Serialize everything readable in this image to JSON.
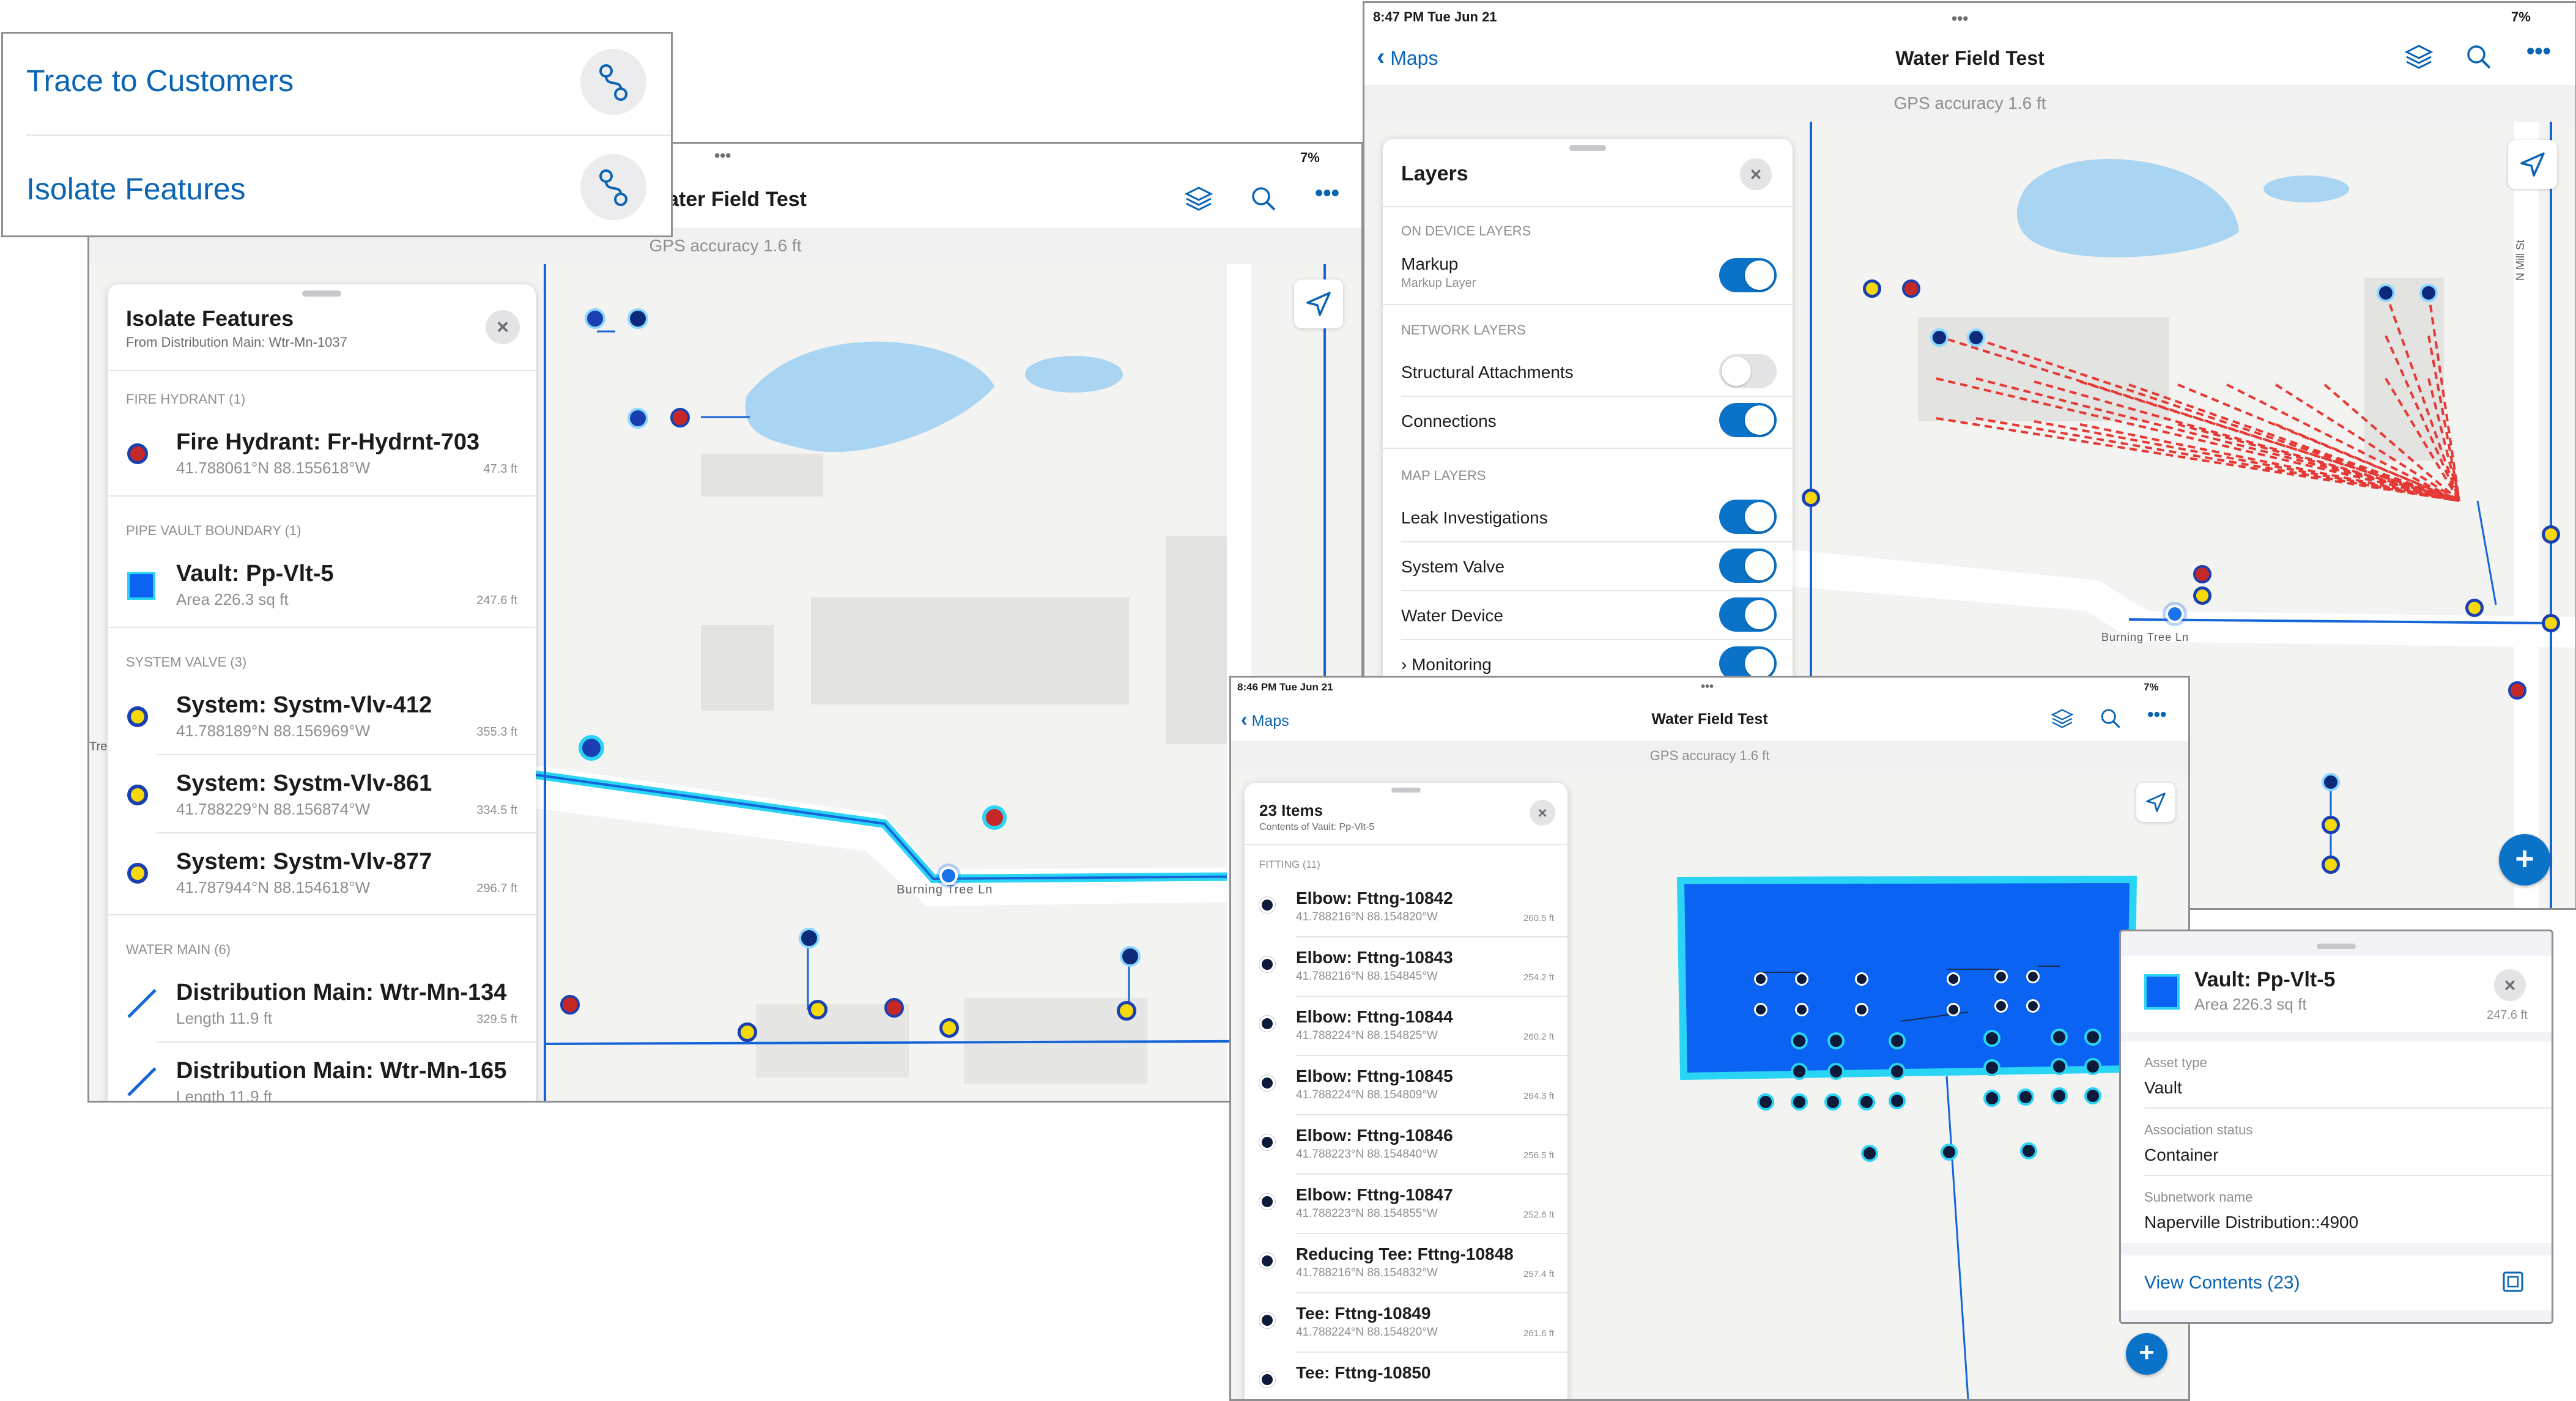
{
  "menu": {
    "trace_label": "Trace to Customers",
    "isolate_label": "Isolate Features"
  },
  "screen_left": {
    "status_battery": "7%",
    "title": "ater Field Test",
    "gps": "GPS accuracy 1.6 ft",
    "street": "Burning Tree Ln",
    "edge_label": "Tre",
    "panel": {
      "title": "Isolate Features",
      "subtitle": "From Distribution Main: Wtr-Mn-1037",
      "sections": {
        "fire_hydrant": "FIRE HYDRANT  (1)",
        "pipe_vault": "PIPE VAULT BOUNDARY  (1)",
        "system_valve": "SYSTEM VALVE  (3)",
        "water_main": "WATER MAIN  (6)"
      },
      "rows": [
        {
          "title": "Fire Hydrant: Fr-Hydrnt-703",
          "sub": "41.788061°N  88.155618°W",
          "dist": "47.3 ft"
        },
        {
          "title": "Vault: Pp-Vlt-5",
          "sub": "Area 226.3 sq ft",
          "dist": "247.6 ft"
        },
        {
          "title": "System: Systm-Vlv-412",
          "sub": "41.788189°N  88.156969°W",
          "dist": "355.3 ft"
        },
        {
          "title": "System: Systm-Vlv-861",
          "sub": "41.788229°N  88.156874°W",
          "dist": "334.5 ft"
        },
        {
          "title": "System: Systm-Vlv-877",
          "sub": "41.787944°N  88.154618°W",
          "dist": "296.7 ft"
        },
        {
          "title": "Distribution Main: Wtr-Mn-134",
          "sub": "Length 11.9 ft",
          "dist": "329.5 ft"
        },
        {
          "title": "Distribution Main: Wtr-Mn-165",
          "sub": "Length 11.9 ft",
          "dist": ""
        }
      ]
    }
  },
  "screen_right": {
    "time": "8:47 PM   Tue Jun 21",
    "status_battery": "7%",
    "back": "Maps",
    "title": "Water Field Test",
    "gps": "GPS accuracy 1.6 ft",
    "street": "Burning Tree Ln",
    "street_vertical": "N Mill St",
    "layers": {
      "title": "Layers",
      "on_device": "ON DEVICE LAYERS",
      "markup": "Markup",
      "markup_sub": "Markup Layer",
      "network": "NETWORK LAYERS",
      "structural": "Structural Attachments",
      "connections": "Connections",
      "map_layers": "MAP LAYERS",
      "leak": "Leak Investigations",
      "system_valve": "System Valve",
      "water_device": "Water Device",
      "monitoring": "Monitoring"
    }
  },
  "screen_bottom": {
    "time": "8:46 PM   Tue Jun 21",
    "status_battery": "7%",
    "back": "Maps",
    "title": "Water Field Test",
    "gps": "GPS accuracy 1.6 ft",
    "list": {
      "title": "23 Items",
      "subtitle": "Contents of Vault: Pp-Vlt-5",
      "section": "FITTING  (11)",
      "rows": [
        {
          "title": "Elbow: Fttng-10842",
          "sub": "41.788216°N  88.154820°W",
          "dist": "260.5 ft"
        },
        {
          "title": "Elbow: Fttng-10843",
          "sub": "41.788216°N  88.154845°W",
          "dist": "254.2 ft"
        },
        {
          "title": "Elbow: Fttng-10844",
          "sub": "41.788224°N  88.154825°W",
          "dist": "260.2 ft"
        },
        {
          "title": "Elbow: Fttng-10845",
          "sub": "41.788224°N  88.154809°W",
          "dist": "264.3 ft"
        },
        {
          "title": "Elbow: Fttng-10846",
          "sub": "41.788223°N  88.154840°W",
          "dist": "256.5 ft"
        },
        {
          "title": "Elbow: Fttng-10847",
          "sub": "41.788223°N  88.154855°W",
          "dist": "252.6 ft"
        },
        {
          "title": "Reducing Tee: Fttng-10848",
          "sub": "41.788216°N  88.154832°W",
          "dist": "257.4 ft"
        },
        {
          "title": "Tee: Fttng-10849",
          "sub": "41.788224°N  88.154820°W",
          "dist": "261.6 ft"
        },
        {
          "title": "Tee: Fttng-10850",
          "sub": "",
          "dist": ""
        }
      ]
    }
  },
  "vault_card": {
    "title": "Vault: Pp-Vlt-5",
    "sub": "Area 226.3 sq ft",
    "dist": "247.6 ft",
    "asset_type_label": "Asset type",
    "asset_type": "Vault",
    "assoc_label": "Association status",
    "assoc": "Container",
    "subnet_label": "Subnetwork name",
    "subnet": "Naperville Distribution::4900",
    "view_contents": "View Contents (23)"
  },
  "colors": {
    "accent": "#0a64b4",
    "toggle_on": "#0a72c7",
    "water_main": "#1565d8",
    "highlight": "#27d7f5",
    "trace": "#e53935",
    "vault_fill": "#0a63f2"
  }
}
